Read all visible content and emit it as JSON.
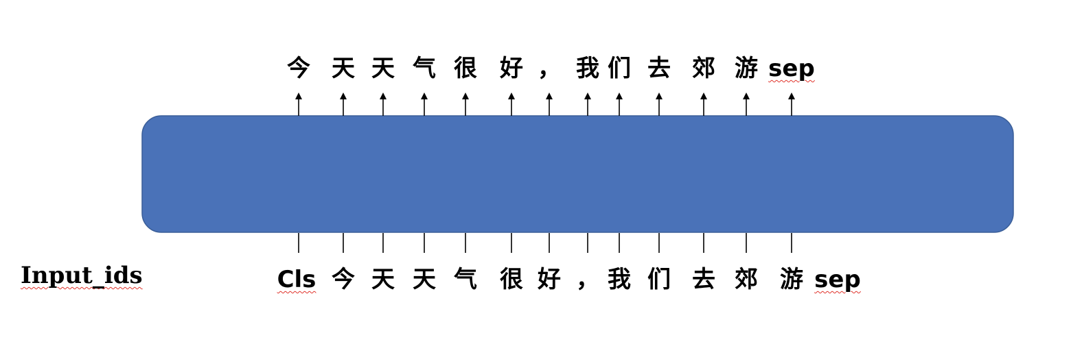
{
  "diagram": {
    "input_label": "Input_ids",
    "output_tokens": [
      "今",
      "天",
      "天",
      "气",
      "很",
      "好",
      "，",
      "我",
      "们",
      "去",
      "郊",
      "游",
      "sep"
    ],
    "input_tokens": [
      "Cls",
      "今",
      "天",
      "天",
      "气",
      "很",
      "好",
      "，",
      "我",
      "们",
      "去",
      "郊",
      "游",
      "sep"
    ],
    "colors": {
      "block_fill": "#4a72b8",
      "block_stroke": "#3a5e98",
      "spellcheck_underline": "#e0322a"
    }
  }
}
